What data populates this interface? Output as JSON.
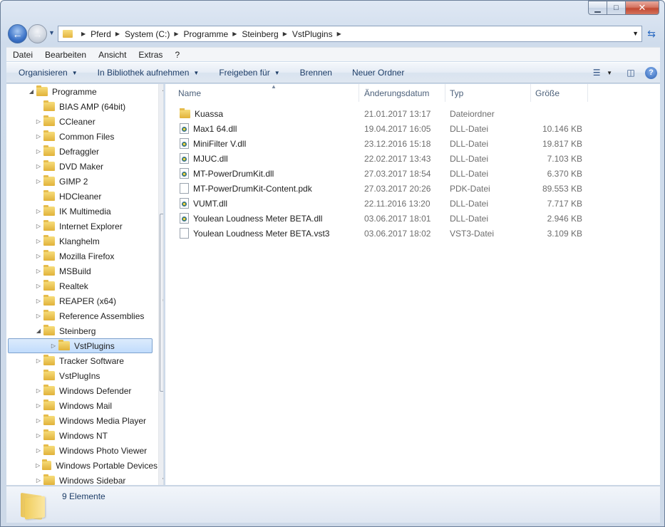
{
  "window": {
    "caption_buttons": {
      "minimize": "▁",
      "maximize": "□",
      "close": "✕"
    }
  },
  "address": {
    "crumbs": [
      "Pferd",
      "System (C:)",
      "Programme",
      "Steinberg",
      "VstPlugins"
    ],
    "separator": "▶"
  },
  "menu": [
    {
      "label": "Datei"
    },
    {
      "label": "Bearbeiten"
    },
    {
      "label": "Ansicht"
    },
    {
      "label": "Extras"
    },
    {
      "label": "?"
    }
  ],
  "commands": {
    "organize": "Organisieren",
    "library": "In Bibliothek aufnehmen",
    "share": "Freigeben für",
    "burn": "Brennen",
    "new_folder": "Neuer Ordner",
    "caret": "▼"
  },
  "tree": [
    {
      "label": "Programme",
      "twisty": "◢",
      "indent": 0
    },
    {
      "label": "BIAS AMP (64bit)",
      "twisty": "",
      "indent": 1
    },
    {
      "label": "CCleaner",
      "twisty": "▷",
      "indent": 1
    },
    {
      "label": "Common Files",
      "twisty": "▷",
      "indent": 1
    },
    {
      "label": "Defraggler",
      "twisty": "▷",
      "indent": 1
    },
    {
      "label": "DVD Maker",
      "twisty": "▷",
      "indent": 1
    },
    {
      "label": "GIMP 2",
      "twisty": "▷",
      "indent": 1
    },
    {
      "label": "HDCleaner",
      "twisty": "",
      "indent": 1
    },
    {
      "label": "IK Multimedia",
      "twisty": "▷",
      "indent": 1
    },
    {
      "label": "Internet Explorer",
      "twisty": "▷",
      "indent": 1
    },
    {
      "label": "Klanghelm",
      "twisty": "▷",
      "indent": 1
    },
    {
      "label": "Mozilla Firefox",
      "twisty": "▷",
      "indent": 1
    },
    {
      "label": "MSBuild",
      "twisty": "▷",
      "indent": 1
    },
    {
      "label": "Realtek",
      "twisty": "▷",
      "indent": 1
    },
    {
      "label": "REAPER (x64)",
      "twisty": "▷",
      "indent": 1
    },
    {
      "label": "Reference Assemblies",
      "twisty": "▷",
      "indent": 1
    },
    {
      "label": "Steinberg",
      "twisty": "◢",
      "indent": 1
    },
    {
      "label": "VstPlugins",
      "twisty": "▷",
      "indent": 2,
      "selected": true
    },
    {
      "label": "Tracker Software",
      "twisty": "▷",
      "indent": 1
    },
    {
      "label": "VstPlugIns",
      "twisty": "",
      "indent": 1
    },
    {
      "label": "Windows Defender",
      "twisty": "▷",
      "indent": 1
    },
    {
      "label": "Windows Mail",
      "twisty": "▷",
      "indent": 1
    },
    {
      "label": "Windows Media Player",
      "twisty": "▷",
      "indent": 1
    },
    {
      "label": "Windows NT",
      "twisty": "▷",
      "indent": 1
    },
    {
      "label": "Windows Photo Viewer",
      "twisty": "▷",
      "indent": 1
    },
    {
      "label": "Windows Portable Devices",
      "twisty": "▷",
      "indent": 1
    },
    {
      "label": "Windows Sidebar",
      "twisty": "▷",
      "indent": 1
    }
  ],
  "columns": {
    "name": "Name",
    "date": "Änderungsdatum",
    "type": "Typ",
    "size": "Größe"
  },
  "files": [
    {
      "name": "Kuassa",
      "date": "21.01.2017 13:17",
      "type": "Dateiordner",
      "size": "",
      "icon": "folder-icon"
    },
    {
      "name": "Max1 64.dll",
      "date": "19.04.2017 16:05",
      "type": "DLL-Datei",
      "size": "10.146 KB",
      "icon": "dll-icon"
    },
    {
      "name": "MiniFilter V.dll",
      "date": "23.12.2016 15:18",
      "type": "DLL-Datei",
      "size": "19.817 KB",
      "icon": "dll-icon"
    },
    {
      "name": "MJUC.dll",
      "date": "22.02.2017 13:43",
      "type": "DLL-Datei",
      "size": "7.103 KB",
      "icon": "dll-icon"
    },
    {
      "name": "MT-PowerDrumKit.dll",
      "date": "27.03.2017 18:54",
      "type": "DLL-Datei",
      "size": "6.370 KB",
      "icon": "dll-icon"
    },
    {
      "name": "MT-PowerDrumKit-Content.pdk",
      "date": "27.03.2017 20:26",
      "type": "PDK-Datei",
      "size": "89.553 KB",
      "icon": "file-icon"
    },
    {
      "name": "VUMT.dll",
      "date": "22.11.2016 13:20",
      "type": "DLL-Datei",
      "size": "7.717 KB",
      "icon": "dll-icon"
    },
    {
      "name": "Youlean Loudness Meter BETA.dll",
      "date": "03.06.2017 18:01",
      "type": "DLL-Datei",
      "size": "2.946 KB",
      "icon": "dll-icon"
    },
    {
      "name": "Youlean Loudness Meter BETA.vst3",
      "date": "03.06.2017 18:02",
      "type": "VST3-Datei",
      "size": "3.109 KB",
      "icon": "file-icon"
    }
  ],
  "status": {
    "count": "9 Elemente"
  }
}
